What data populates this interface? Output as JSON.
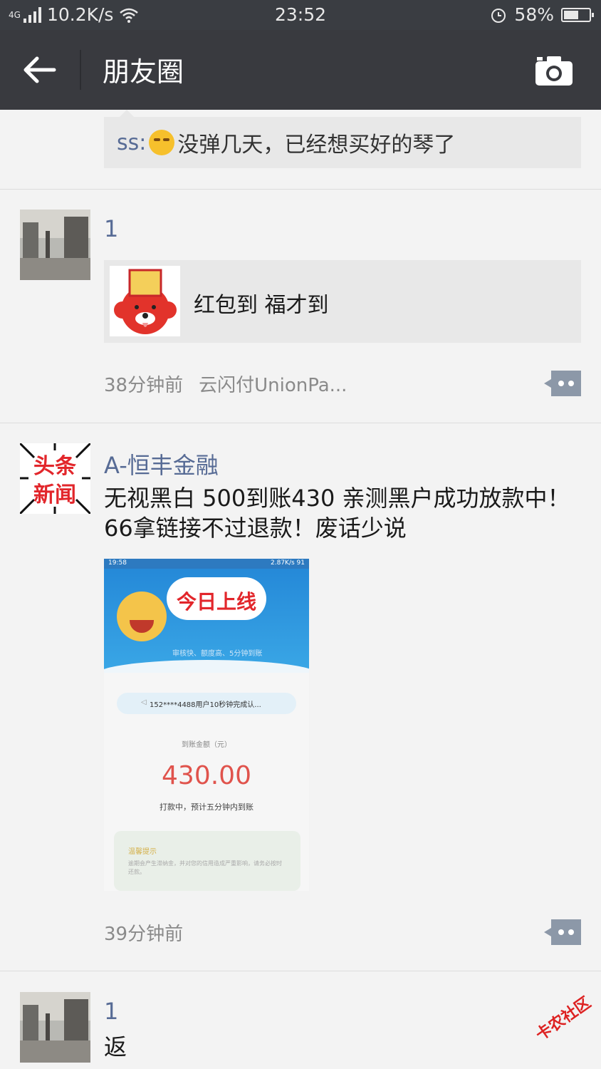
{
  "status_bar": {
    "network": "4G",
    "speed": "10.2K/s",
    "time": "23:52",
    "battery": "58%",
    "battery_level": 0.58
  },
  "header": {
    "title": "朋友圈"
  },
  "comment": {
    "author": "ss:",
    "text": "没弹几天，已经想买好的琴了"
  },
  "posts": [
    {
      "name": "1",
      "share": {
        "title": "红包到 福才到",
        "thumb_text": "红包到 福才到"
      },
      "time": "38分钟前",
      "location": "云闪付UnionPa..."
    },
    {
      "name": "A-恒丰金融",
      "avatar_text": "头条新闻",
      "text": "无视黑白 500到账430 亲测黑户成功放款中！66拿链接不过退款！废话少说",
      "image": {
        "status_time": "19:58",
        "status_right": "2.87K/s  91",
        "banner_title": "今日上线",
        "banner_slogan": "审核快、额度高、5分钟到账",
        "notice": "152****4488用户10秒钟完成认...",
        "amount_label": "到账金额（元）",
        "amount": "430.00",
        "progress": "打款中，预计五分钟内到账",
        "tip_title": "温馨提示",
        "tip_body": "逾期会产生滞纳金，并对您的信用造成严重影响，请务必按时还款。"
      },
      "time": "39分钟前"
    },
    {
      "name": "1",
      "text": "返"
    }
  ],
  "watermark": "卡农社区"
}
